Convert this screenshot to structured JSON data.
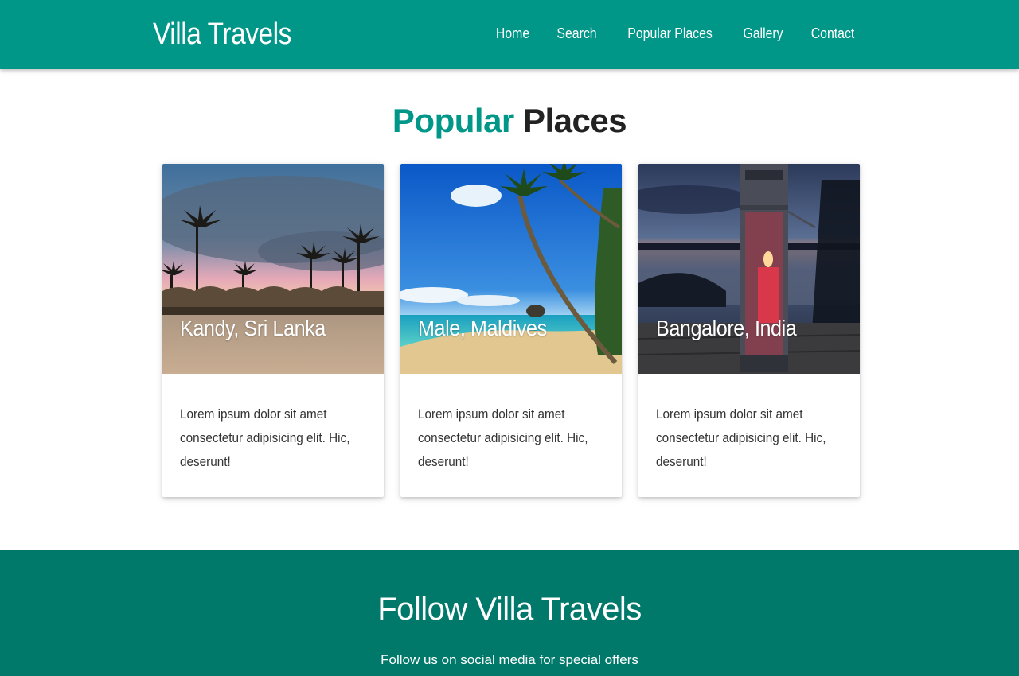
{
  "brand": "Villa Travels",
  "nav": [
    "Home",
    "Search",
    "Popular Places",
    "Gallery",
    "Contact"
  ],
  "section": {
    "title_accent": "Popular",
    "title_rest": "Places"
  },
  "cards": [
    {
      "title": "Kandy, Sri Lanka",
      "text": "Lorem ipsum dolor sit amet consectetur adipisicing elit. Hic, deserunt!"
    },
    {
      "title": "Male, Maldives",
      "text": "Lorem ipsum dolor sit amet consectetur adipisicing elit. Hic, deserunt!"
    },
    {
      "title": "Bangalore, India",
      "text": "Lorem ipsum dolor sit amet consectetur adipisicing elit. Hic, deserunt!"
    }
  ],
  "footer": {
    "title": "Follow Villa Travels",
    "subtitle": "Follow us on social media for special offers"
  },
  "colors": {
    "primary": "#009688",
    "footer": "#00796b"
  }
}
